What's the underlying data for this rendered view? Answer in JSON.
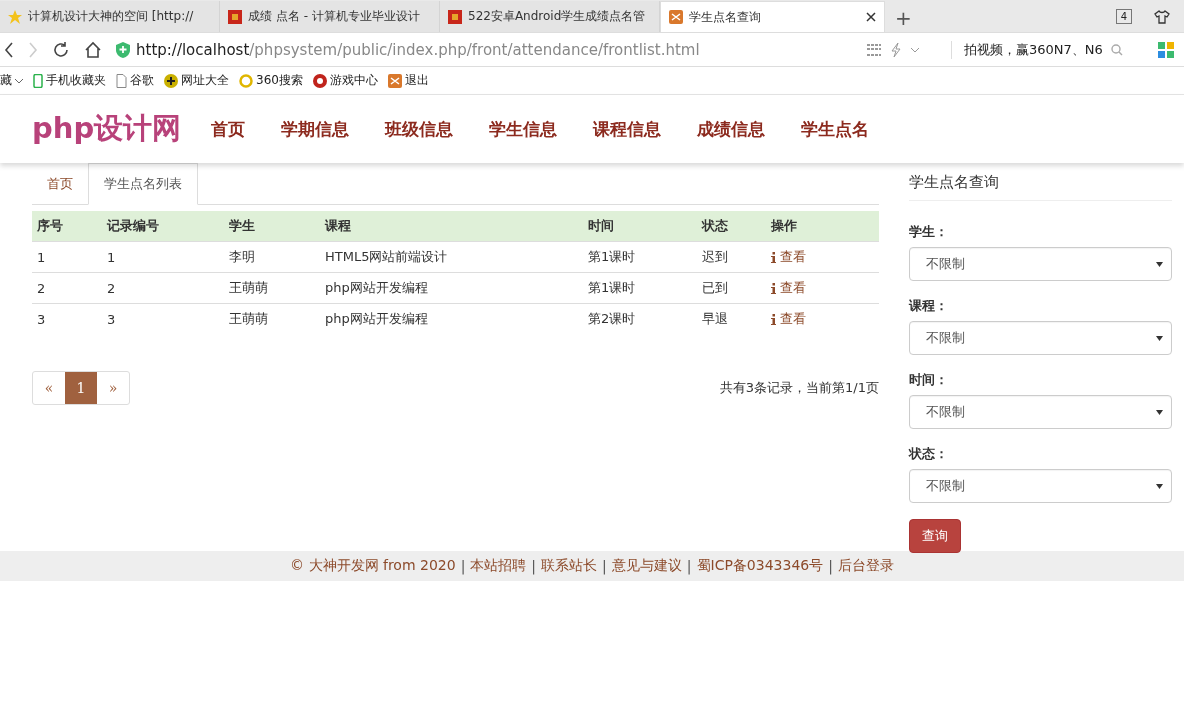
{
  "browser": {
    "tabs": [
      {
        "title": "计算机设计大神的空间 [http://",
        "kind": "star",
        "selected": false
      },
      {
        "title": "成绩 点名 - 计算机专业毕业设计",
        "kind": "red",
        "selected": false
      },
      {
        "title": "522安卓Android学生成绩点名管",
        "kind": "red",
        "selected": false
      },
      {
        "title": "学生点名查询",
        "kind": "orange",
        "selected": true
      }
    ],
    "new_tab": "+",
    "tab_count": "4",
    "url_host": "http://localhost",
    "url_path": "/phpsystem/public/index.php/front/attendance/frontlist.html",
    "search_text": "拍视频，赢360N7、N6",
    "bookmarks": [
      {
        "label": "藏",
        "kind": "caret"
      },
      {
        "label": "手机收藏夹",
        "kind": "phone"
      },
      {
        "label": "谷歌",
        "kind": "page"
      },
      {
        "label": "网址大全",
        "kind": "plus"
      },
      {
        "label": "360搜索",
        "kind": "ring"
      },
      {
        "label": "游戏中心",
        "kind": "game"
      },
      {
        "label": "退出",
        "kind": "exit"
      }
    ]
  },
  "site": {
    "logo": "php设计网",
    "nav": [
      "首页",
      "学期信息",
      "班级信息",
      "学生信息",
      "课程信息",
      "成绩信息",
      "学生点名"
    ]
  },
  "breadcrumb_tabs": [
    {
      "label": "首页",
      "selected": false
    },
    {
      "label": "学生点名列表",
      "selected": true
    }
  ],
  "table": {
    "columns": [
      "序号",
      "记录编号",
      "学生",
      "课程",
      "时间",
      "状态",
      "操作"
    ],
    "rows": [
      [
        "1",
        "1",
        "李明",
        "HTML5网站前端设计",
        "第1课时",
        "迟到",
        "查看"
      ],
      [
        "2",
        "2",
        "王萌萌",
        "php网站开发编程",
        "第1课时",
        "已到",
        "查看"
      ],
      [
        "3",
        "3",
        "王萌萌",
        "php网站开发编程",
        "第2课时",
        "早退",
        "查看"
      ]
    ]
  },
  "pagination": {
    "prev": "«",
    "pages": [
      {
        "label": "1",
        "selected": true
      }
    ],
    "next": "»",
    "summary": "共有3条记录，当前第1/1页"
  },
  "filter": {
    "title": "学生点名查询",
    "fields": [
      {
        "label": "学生：",
        "value": "不限制"
      },
      {
        "label": "课程：",
        "value": "不限制"
      },
      {
        "label": "时间：",
        "value": "不限制"
      },
      {
        "label": "状态：",
        "value": "不限制"
      }
    ],
    "submit": "查询"
  },
  "footer": {
    "separator": "|",
    "items": [
      "© 大神开发网 from 2020",
      "本站招聘",
      "联系站长",
      "意见与建议",
      "蜀ICP备0343346号",
      "后台登录"
    ]
  }
}
